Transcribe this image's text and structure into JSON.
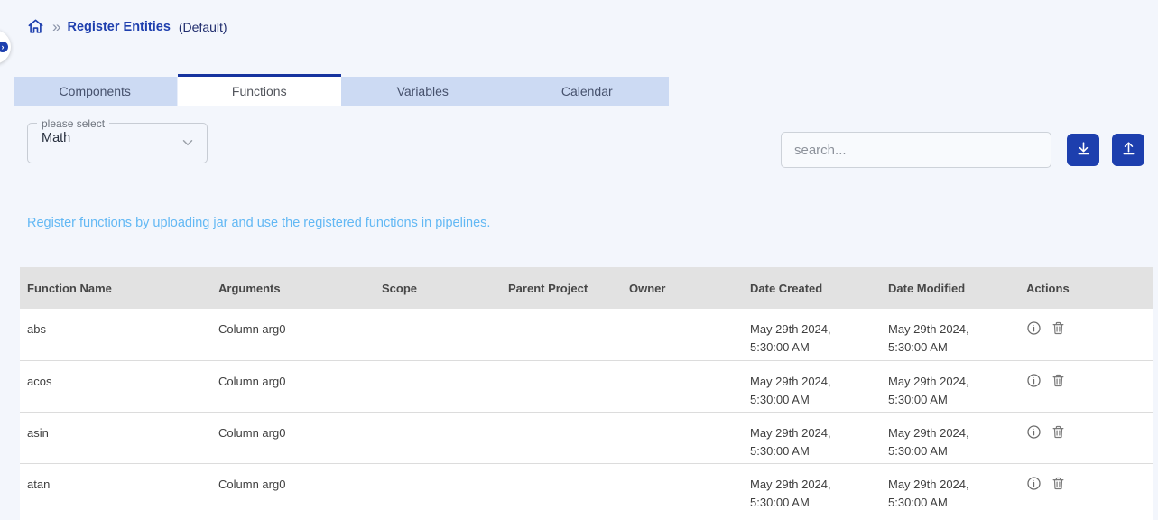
{
  "breadcrumb": {
    "title": "Register Entities",
    "subtitle": "(Default)",
    "separator": "»"
  },
  "tabs": [
    {
      "label": "Components",
      "active": false
    },
    {
      "label": "Functions",
      "active": true
    },
    {
      "label": "Variables",
      "active": false
    },
    {
      "label": "Calendar",
      "active": false
    }
  ],
  "filter": {
    "label": "please select",
    "value": "Math"
  },
  "search": {
    "placeholder": "search..."
  },
  "info_text": "Register functions by uploading jar and use the registered functions in pipelines.",
  "table": {
    "columns": [
      "Function Name",
      "Arguments",
      "Scope",
      "Parent Project",
      "Owner",
      "Date Created",
      "Date Modified",
      "Actions"
    ],
    "rows": [
      {
        "function_name": "abs",
        "arguments": "Column arg0",
        "scope": "",
        "parent_project": "",
        "owner": "",
        "date_created": "May 29th 2024, 5:30:00 AM",
        "date_modified": "May 29th 2024, 5:30:00 AM"
      },
      {
        "function_name": "acos",
        "arguments": "Column arg0",
        "scope": "",
        "parent_project": "",
        "owner": "",
        "date_created": "May 29th 2024, 5:30:00 AM",
        "date_modified": "May 29th 2024, 5:30:00 AM"
      },
      {
        "function_name": "asin",
        "arguments": "Column arg0",
        "scope": "",
        "parent_project": "",
        "owner": "",
        "date_created": "May 29th 2024, 5:30:00 AM",
        "date_modified": "May 29th 2024, 5:30:00 AM"
      },
      {
        "function_name": "atan",
        "arguments": "Column arg0",
        "scope": "",
        "parent_project": "",
        "owner": "",
        "date_created": "May 29th 2024, 5:30:00 AM",
        "date_modified": "May 29th 2024, 5:30:00 AM"
      }
    ]
  },
  "colors": {
    "primary_blue": "#1d3fae",
    "active_tab_border": "#16349f",
    "tab_background": "#ccdaf3",
    "page_background": "#f3f6fc",
    "info_blue": "#62b8f4",
    "header_gray": "#e2e2e2"
  }
}
